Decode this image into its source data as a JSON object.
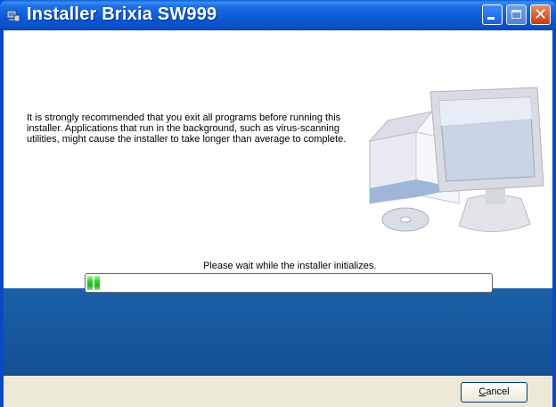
{
  "window": {
    "title": "Installer Brixia SW999",
    "controls": {
      "minimize": "minimize",
      "maximize": "maximize",
      "close": "close"
    }
  },
  "content": {
    "message": "It is strongly recommended that you exit all programs before running this installer. Applications that run in the background, such as virus-scanning utilities, might cause the installer to take longer than average to complete.",
    "status_text": "Please wait while the installer initializes.",
    "progress": 0.03
  },
  "buttons": {
    "cancel_accel": "C",
    "cancel_rest": "ancel"
  },
  "colors": {
    "titlebar": "#0a52c9",
    "band": "#1a5aa0",
    "progress": "#1fb31a",
    "footer": "#ece9d8"
  },
  "icons": {
    "title_icon": "installer-icon",
    "illustration": "computer-illustration-icon"
  }
}
